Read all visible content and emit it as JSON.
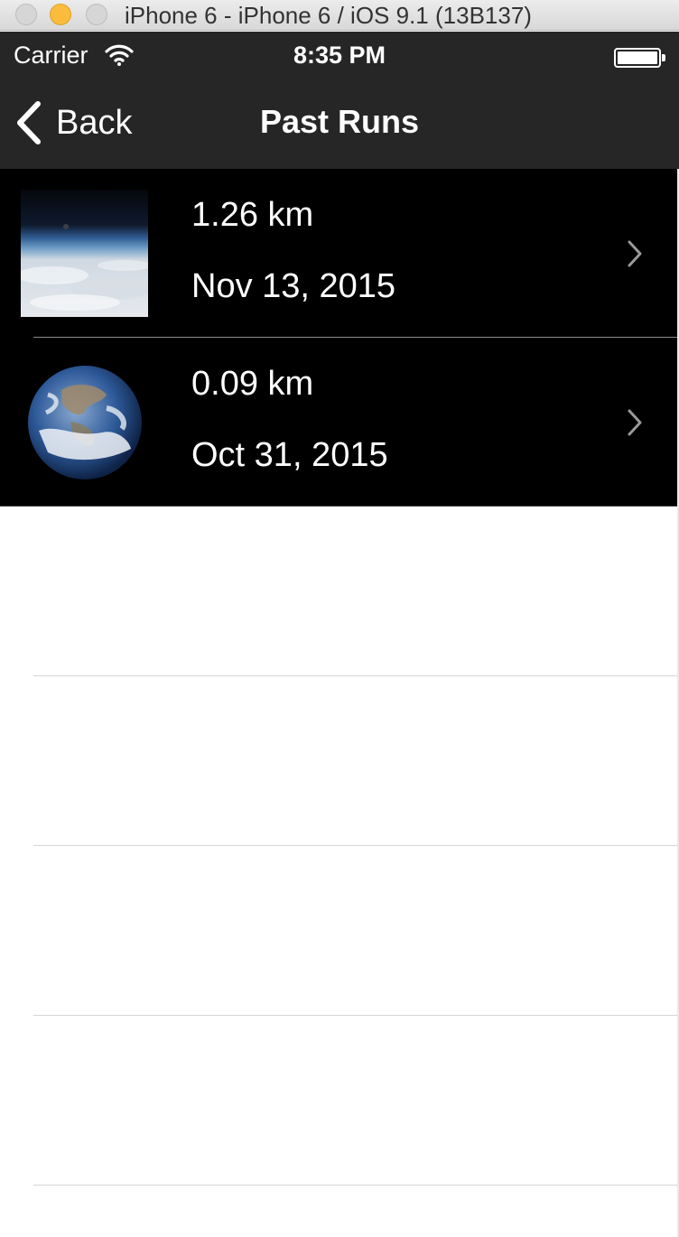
{
  "window": {
    "title": "iPhone 6 - iPhone 6 / iOS 9.1 (13B137)"
  },
  "status_bar": {
    "carrier": "Carrier",
    "time": "8:35 PM"
  },
  "nav_bar": {
    "back_label": "Back",
    "title": "Past Runs"
  },
  "runs": [
    {
      "distance": "1.26 km",
      "date": "Nov 13, 2015",
      "thumbnail": "earth-horizon-photo"
    },
    {
      "distance": "0.09 km",
      "date": "Oct 31, 2015",
      "thumbnail": "earth-globe-photo"
    }
  ],
  "colors": {
    "bar_background": "#262626",
    "row_background": "#000000",
    "text": "#ffffff"
  }
}
